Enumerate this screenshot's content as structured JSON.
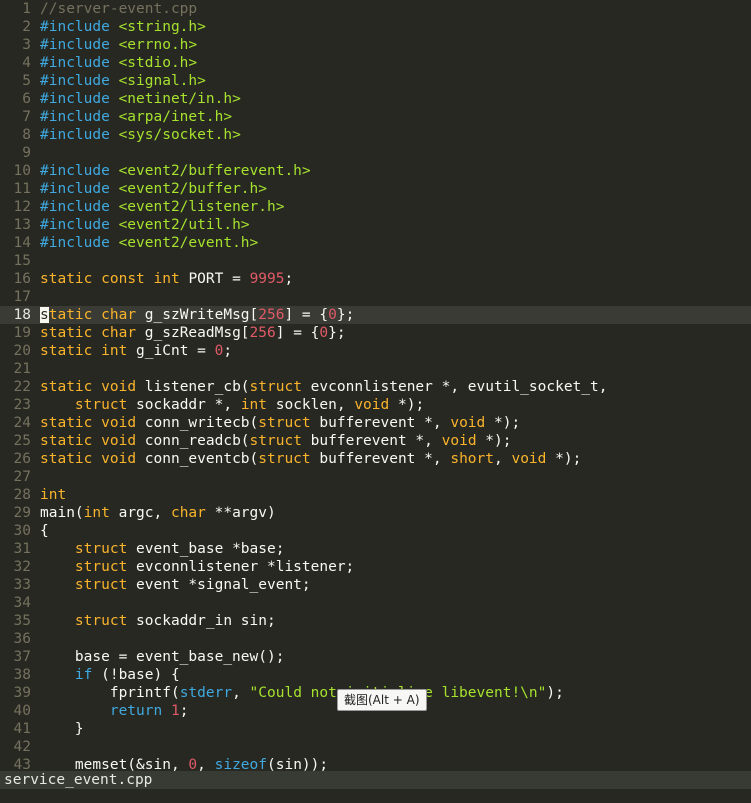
{
  "editor": {
    "current_line": 18,
    "lines": [
      [
        [
          "cmt",
          "//server-event.cpp"
        ]
      ],
      [
        [
          "pp",
          "#include"
        ],
        [
          "sym",
          " "
        ],
        [
          "str",
          "<string.h>"
        ]
      ],
      [
        [
          "pp",
          "#include"
        ],
        [
          "sym",
          " "
        ],
        [
          "str",
          "<errno.h>"
        ]
      ],
      [
        [
          "pp",
          "#include"
        ],
        [
          "sym",
          " "
        ],
        [
          "str",
          "<stdio.h>"
        ]
      ],
      [
        [
          "pp",
          "#include"
        ],
        [
          "sym",
          " "
        ],
        [
          "str",
          "<signal.h>"
        ]
      ],
      [
        [
          "pp",
          "#include"
        ],
        [
          "sym",
          " "
        ],
        [
          "str",
          "<netinet/in.h>"
        ]
      ],
      [
        [
          "pp",
          "#include"
        ],
        [
          "sym",
          " "
        ],
        [
          "str",
          "<arpa/inet.h>"
        ]
      ],
      [
        [
          "pp",
          "#include"
        ],
        [
          "sym",
          " "
        ],
        [
          "str",
          "<sys/socket.h>"
        ]
      ],
      [],
      [
        [
          "pp",
          "#include"
        ],
        [
          "sym",
          " "
        ],
        [
          "str",
          "<event2/bufferevent.h>"
        ]
      ],
      [
        [
          "pp",
          "#include"
        ],
        [
          "sym",
          " "
        ],
        [
          "str",
          "<event2/buffer.h>"
        ]
      ],
      [
        [
          "pp",
          "#include"
        ],
        [
          "sym",
          " "
        ],
        [
          "str",
          "<event2/listener.h>"
        ]
      ],
      [
        [
          "pp",
          "#include"
        ],
        [
          "sym",
          " "
        ],
        [
          "str",
          "<event2/util.h>"
        ]
      ],
      [
        [
          "pp",
          "#include"
        ],
        [
          "sym",
          " "
        ],
        [
          "str",
          "<event2/event.h>"
        ]
      ],
      [],
      [
        [
          "kw",
          "static"
        ],
        [
          "sym",
          " "
        ],
        [
          "kw",
          "const"
        ],
        [
          "sym",
          " "
        ],
        [
          "kw",
          "int"
        ],
        [
          "id",
          " PORT = "
        ],
        [
          "num",
          "9995"
        ],
        [
          "sym",
          ";"
        ]
      ],
      [],
      [
        [
          "cursor",
          "s"
        ],
        [
          "kw",
          "tatic"
        ],
        [
          "sym",
          " "
        ],
        [
          "kw",
          "char"
        ],
        [
          "id",
          " g_szWriteMsg["
        ],
        [
          "num",
          "256"
        ],
        [
          "id",
          "] = {"
        ],
        [
          "num",
          "0"
        ],
        [
          "id",
          "};"
        ]
      ],
      [
        [
          "kw",
          "static"
        ],
        [
          "sym",
          " "
        ],
        [
          "kw",
          "char"
        ],
        [
          "id",
          " g_szReadMsg["
        ],
        [
          "num",
          "256"
        ],
        [
          "id",
          "] = {"
        ],
        [
          "num",
          "0"
        ],
        [
          "id",
          "};"
        ]
      ],
      [
        [
          "kw",
          "static"
        ],
        [
          "sym",
          " "
        ],
        [
          "kw",
          "int"
        ],
        [
          "id",
          " g_iCnt = "
        ],
        [
          "num",
          "0"
        ],
        [
          "sym",
          ";"
        ]
      ],
      [],
      [
        [
          "kw",
          "static"
        ],
        [
          "sym",
          " "
        ],
        [
          "kw",
          "void"
        ],
        [
          "id",
          " listener_cb("
        ],
        [
          "kw",
          "struct"
        ],
        [
          "id",
          " evconnlistener *, evutil_socket_t,"
        ]
      ],
      [
        [
          "sym",
          "    "
        ],
        [
          "kw",
          "struct"
        ],
        [
          "id",
          " sockaddr *, "
        ],
        [
          "kw",
          "int"
        ],
        [
          "id",
          " socklen, "
        ],
        [
          "kw",
          "void"
        ],
        [
          "id",
          " *);"
        ]
      ],
      [
        [
          "kw",
          "static"
        ],
        [
          "sym",
          " "
        ],
        [
          "kw",
          "void"
        ],
        [
          "id",
          " conn_writecb("
        ],
        [
          "kw",
          "struct"
        ],
        [
          "id",
          " bufferevent *, "
        ],
        [
          "kw",
          "void"
        ],
        [
          "id",
          " *);"
        ]
      ],
      [
        [
          "kw",
          "static"
        ],
        [
          "sym",
          " "
        ],
        [
          "kw",
          "void"
        ],
        [
          "id",
          " conn_readcb("
        ],
        [
          "kw",
          "struct"
        ],
        [
          "id",
          " bufferevent *, "
        ],
        [
          "kw",
          "void"
        ],
        [
          "id",
          " *);"
        ]
      ],
      [
        [
          "kw",
          "static"
        ],
        [
          "sym",
          " "
        ],
        [
          "kw",
          "void"
        ],
        [
          "id",
          " conn_eventcb("
        ],
        [
          "kw",
          "struct"
        ],
        [
          "id",
          " bufferevent *, "
        ],
        [
          "kw",
          "short"
        ],
        [
          "id",
          ", "
        ],
        [
          "kw",
          "void"
        ],
        [
          "id",
          " *);"
        ]
      ],
      [],
      [
        [
          "kw",
          "int"
        ]
      ],
      [
        [
          "id",
          "main("
        ],
        [
          "kw",
          "int"
        ],
        [
          "id",
          " argc, "
        ],
        [
          "kw",
          "char"
        ],
        [
          "id",
          " **argv)"
        ]
      ],
      [
        [
          "id",
          "{"
        ]
      ],
      [
        [
          "sym",
          "    "
        ],
        [
          "kw",
          "struct"
        ],
        [
          "id",
          " event_base *base;"
        ]
      ],
      [
        [
          "sym",
          "    "
        ],
        [
          "kw",
          "struct"
        ],
        [
          "id",
          " evconnlistener *listener;"
        ]
      ],
      [
        [
          "sym",
          "    "
        ],
        [
          "kw",
          "struct"
        ],
        [
          "id",
          " event *signal_event;"
        ]
      ],
      [],
      [
        [
          "sym",
          "    "
        ],
        [
          "kw",
          "struct"
        ],
        [
          "id",
          " sockaddr_in sin;"
        ]
      ],
      [],
      [
        [
          "id",
          "    base = event_base_new();"
        ]
      ],
      [
        [
          "sym",
          "    "
        ],
        [
          "fn",
          "if"
        ],
        [
          "id",
          " (!base) {"
        ]
      ],
      [
        [
          "id",
          "        fprintf("
        ],
        [
          "fn",
          "stderr"
        ],
        [
          "id",
          ", "
        ],
        [
          "str",
          "\"Could not initialize libevent!\\n\""
        ],
        [
          "id",
          ");"
        ]
      ],
      [
        [
          "sym",
          "        "
        ],
        [
          "fn",
          "return"
        ],
        [
          "sym",
          " "
        ],
        [
          "num",
          "1"
        ],
        [
          "sym",
          ";"
        ]
      ],
      [
        [
          "id",
          "    }"
        ]
      ],
      [],
      [
        [
          "id",
          "    memset(&sin, "
        ],
        [
          "num",
          "0"
        ],
        [
          "id",
          ", "
        ],
        [
          "fn",
          "sizeof"
        ],
        [
          "id",
          "(sin));"
        ]
      ]
    ]
  },
  "statusbar": {
    "filename": "service_event.cpp"
  },
  "tooltip": {
    "text": "截图(Alt + A)"
  },
  "colors": {
    "background": "#272822",
    "keyword": "#f9b42c",
    "preprocessor": "#3fa9e0",
    "string": "#a6e22e",
    "number": "#e05a67",
    "comment": "#75715e",
    "line_number": "#75715e"
  }
}
